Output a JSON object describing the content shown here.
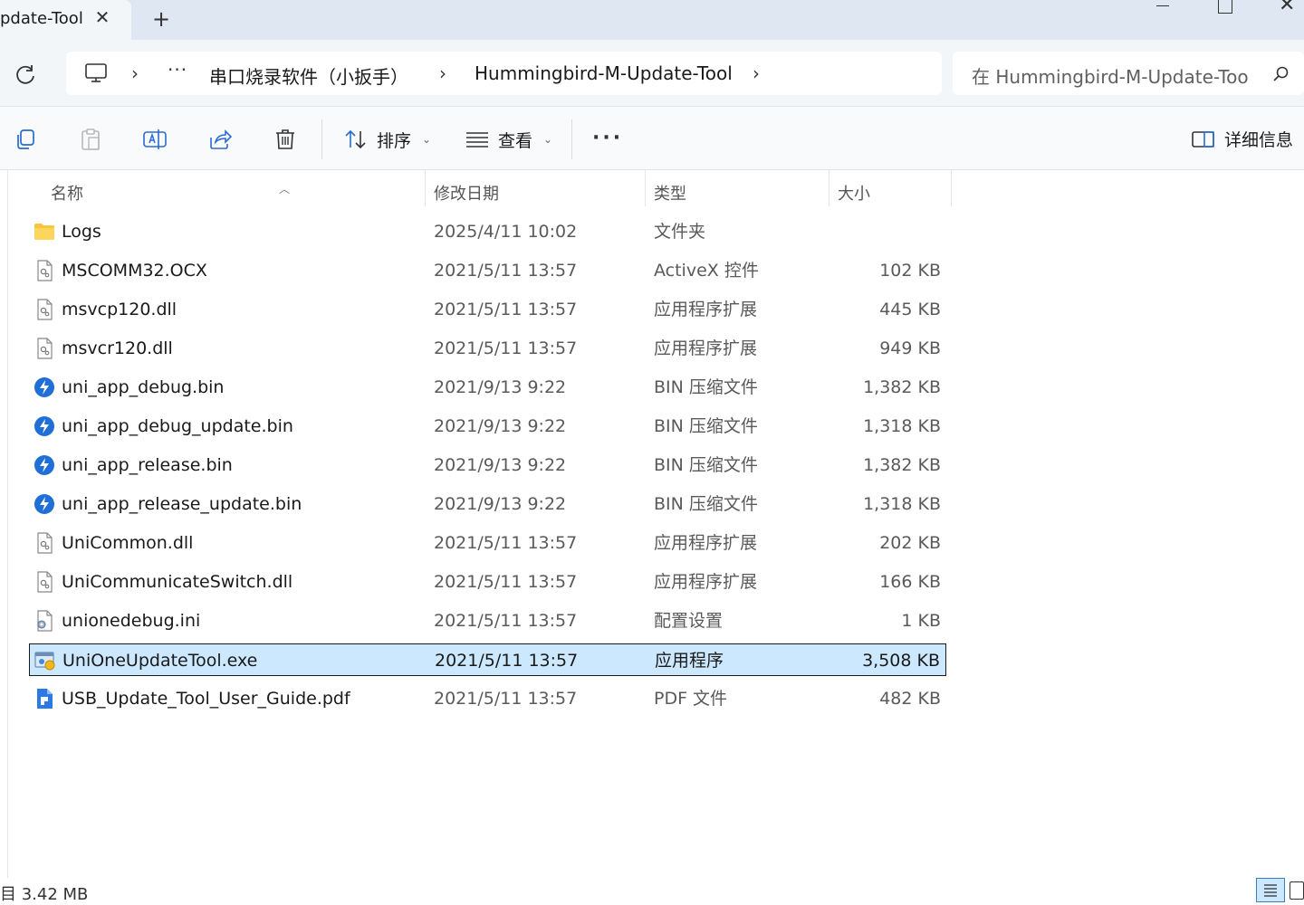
{
  "window": {
    "tab_title": "pdate-Tool"
  },
  "address": {
    "crumbs": [
      "串口烧录软件（小扳手）",
      "Hummingbird-M-Update-Tool"
    ],
    "search_placeholder": "在 Hummingbird-M-Update-Too"
  },
  "commandbar": {
    "sort_label": "排序",
    "view_label": "查看",
    "details_label": "详细信息"
  },
  "columns": {
    "name": "名称",
    "date": "修改日期",
    "type": "类型",
    "size": "大小"
  },
  "files": [
    {
      "name": "Logs",
      "date": "2025/4/11 10:02",
      "type": "文件夹",
      "size": "",
      "icon": "folder-icon"
    },
    {
      "name": "MSCOMM32.OCX",
      "date": "2021/5/11 13:57",
      "type": "ActiveX 控件",
      "size": "102 KB",
      "icon": "system-file-icon"
    },
    {
      "name": "msvcp120.dll",
      "date": "2021/5/11 13:57",
      "type": "应用程序扩展",
      "size": "445 KB",
      "icon": "system-file-icon"
    },
    {
      "name": "msvcr120.dll",
      "date": "2021/5/11 13:57",
      "type": "应用程序扩展",
      "size": "949 KB",
      "icon": "system-file-icon"
    },
    {
      "name": "uni_app_debug.bin",
      "date": "2021/9/13 9:22",
      "type": "BIN 压缩文件",
      "size": "1,382 KB",
      "icon": "bin-archive-icon"
    },
    {
      "name": "uni_app_debug_update.bin",
      "date": "2021/9/13 9:22",
      "type": "BIN 压缩文件",
      "size": "1,318 KB",
      "icon": "bin-archive-icon"
    },
    {
      "name": "uni_app_release.bin",
      "date": "2021/9/13 9:22",
      "type": "BIN 压缩文件",
      "size": "1,382 KB",
      "icon": "bin-archive-icon"
    },
    {
      "name": "uni_app_release_update.bin",
      "date": "2021/9/13 9:22",
      "type": "BIN 压缩文件",
      "size": "1,318 KB",
      "icon": "bin-archive-icon"
    },
    {
      "name": "UniCommon.dll",
      "date": "2021/5/11 13:57",
      "type": "应用程序扩展",
      "size": "202 KB",
      "icon": "system-file-icon"
    },
    {
      "name": "UniCommunicateSwitch.dll",
      "date": "2021/5/11 13:57",
      "type": "应用程序扩展",
      "size": "166 KB",
      "icon": "system-file-icon"
    },
    {
      "name": "unionedebug.ini",
      "date": "2021/5/11 13:57",
      "type": "配置设置",
      "size": "1 KB",
      "icon": "settings-file-icon"
    },
    {
      "name": "UniOneUpdateTool.exe",
      "date": "2021/5/11 13:57",
      "type": "应用程序",
      "size": "3,508 KB",
      "icon": "application-icon",
      "selected": true
    },
    {
      "name": "USB_Update_Tool_User_Guide.pdf",
      "date": "2021/5/11 13:57",
      "type": "PDF 文件",
      "size": "482 KB",
      "icon": "pdf-file-icon"
    }
  ],
  "status": {
    "text": "目  3.42 MB"
  },
  "colors": {
    "selection": "#cce8ff",
    "accent": "#1a73e8"
  }
}
